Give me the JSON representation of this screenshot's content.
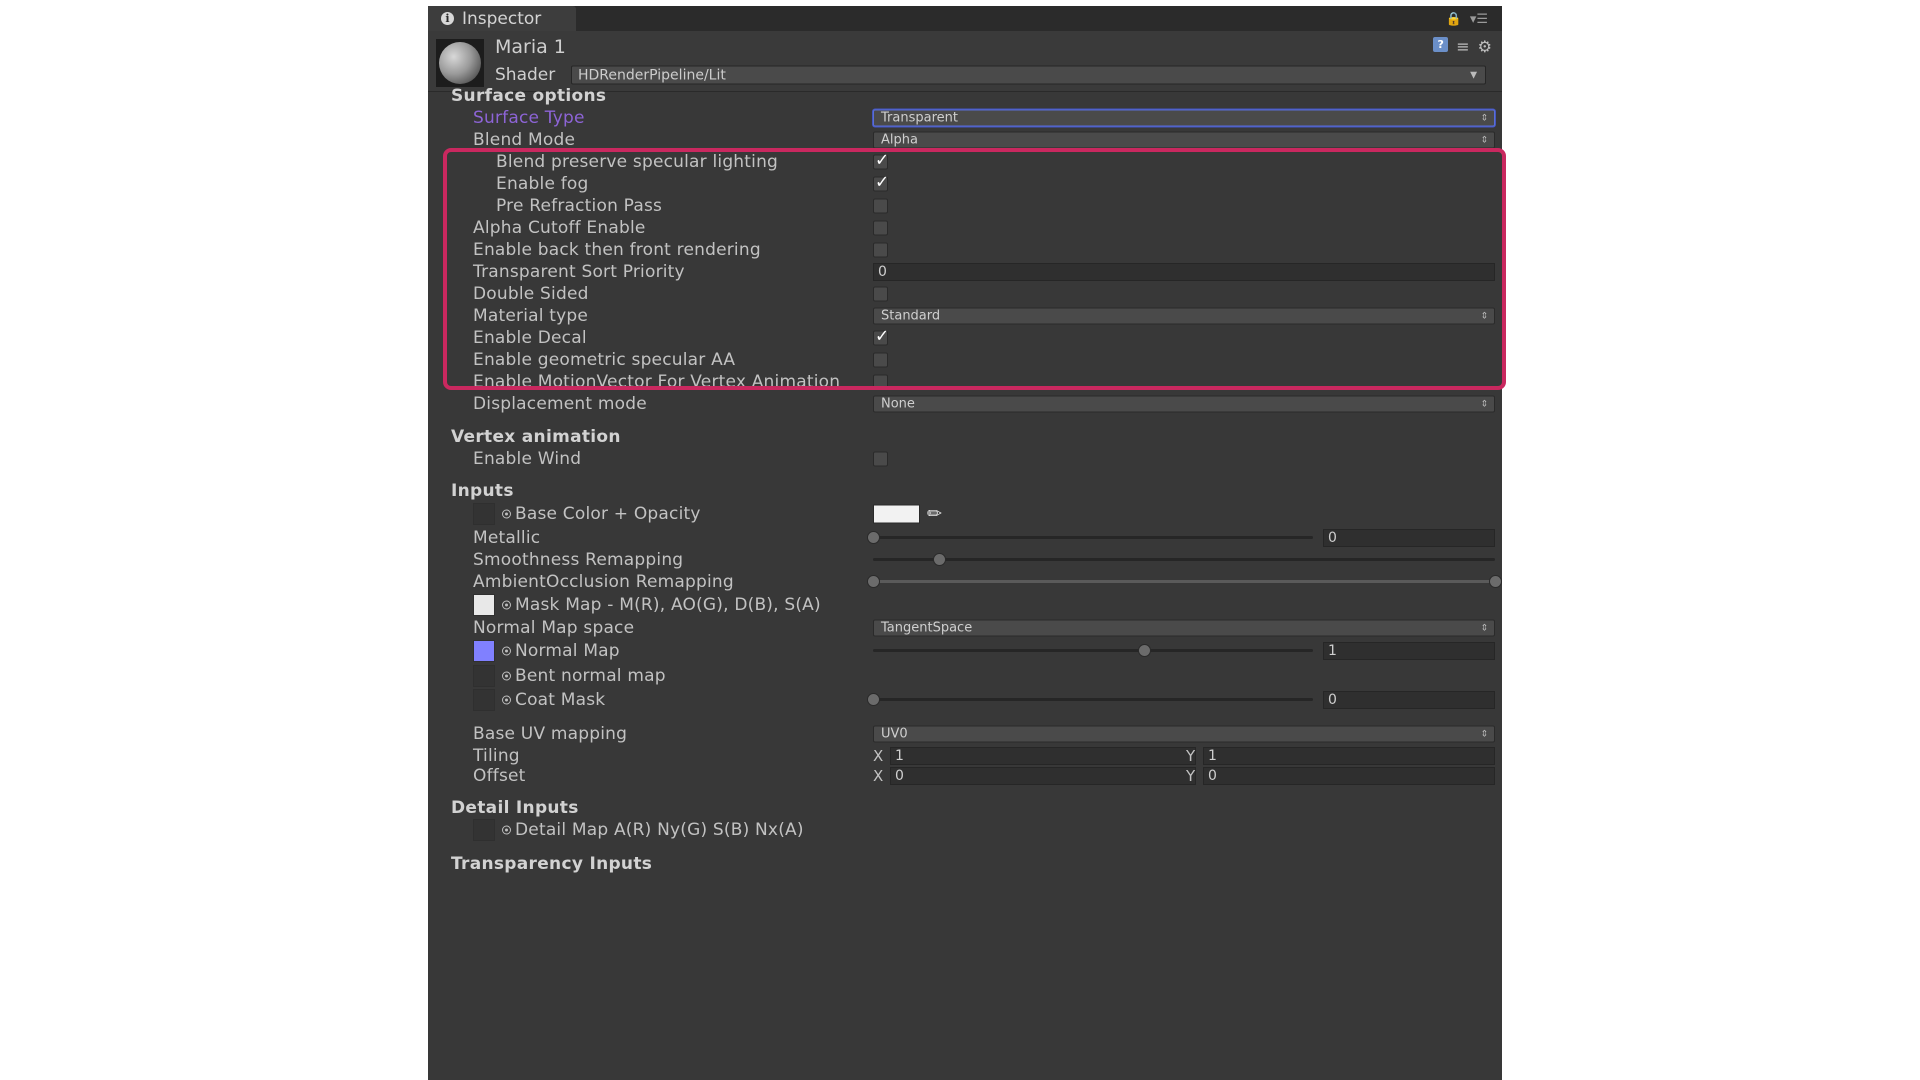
{
  "tab": {
    "title": "Inspector"
  },
  "header": {
    "material_name": "Maria 1",
    "shader_label": "Shader",
    "shader_value": "HDRenderPipeline/Lit"
  },
  "sections": {
    "surface_options": "Surface options",
    "vertex_animation": "Vertex animation",
    "inputs": "Inputs",
    "detail_inputs": "Detail Inputs",
    "transparency_inputs": "Transparency Inputs"
  },
  "surface": {
    "surface_type": {
      "label": "Surface Type",
      "value": "Transparent"
    },
    "blend_mode": {
      "label": "Blend Mode",
      "value": "Alpha"
    },
    "blend_preserve": {
      "label": "Blend preserve specular lighting",
      "checked": true
    },
    "enable_fog": {
      "label": "Enable fog",
      "checked": true
    },
    "pre_refraction": {
      "label": "Pre Refraction Pass",
      "checked": false
    },
    "alpha_cutoff": {
      "label": "Alpha Cutoff Enable",
      "checked": false
    },
    "back_front": {
      "label": "Enable back then front rendering",
      "checked": false
    },
    "sort_priority": {
      "label": "Transparent Sort Priority",
      "value": "0"
    },
    "double_sided": {
      "label": "Double Sided",
      "checked": false
    },
    "material_type": {
      "label": "Material type",
      "value": "Standard"
    },
    "enable_decal": {
      "label": "Enable Decal",
      "checked": true
    },
    "geometric_aa": {
      "label": "Enable geometric specular AA",
      "checked": false
    },
    "motion_vector": {
      "label": "Enable MotionVector For Vertex Animation",
      "checked": false
    },
    "displacement": {
      "label": "Displacement mode",
      "value": "None"
    }
  },
  "vertex": {
    "enable_wind": {
      "label": "Enable Wind",
      "checked": false
    }
  },
  "inputs": {
    "base_color": {
      "label": "Base Color + Opacity"
    },
    "metallic": {
      "label": "Metallic",
      "value": "0",
      "slider": 0.0
    },
    "smoothness": {
      "label": "Smoothness Remapping",
      "slider": 0.1
    },
    "ao_remap": {
      "label": "AmbientOcclusion Remapping"
    },
    "mask_map": {
      "label": "Mask Map - M(R), AO(G), D(B), S(A)"
    },
    "normal_space": {
      "label": "Normal Map space",
      "value": "TangentSpace"
    },
    "normal_map": {
      "label": "Normal Map",
      "value": "1",
      "slider": 0.5
    },
    "bent_normal": {
      "label": "Bent normal map"
    },
    "coat_mask": {
      "label": "Coat Mask",
      "value": "0",
      "slider": 0.0
    },
    "base_uv": {
      "label": "Base UV mapping",
      "value": "UV0"
    },
    "tiling": {
      "label": "Tiling",
      "x_label": "X",
      "x": "1",
      "y_label": "Y",
      "y": "1"
    },
    "offset": {
      "label": "Offset",
      "x_label": "X",
      "x": "0",
      "y_label": "Y",
      "y": "0"
    }
  },
  "detail": {
    "detail_map": {
      "label": "Detail Map A(R) Ny(G) S(B) Nx(A)"
    }
  },
  "colors": {
    "highlight": "#c9285f",
    "panel": "#383838",
    "accent_label": "#8d64d6"
  }
}
